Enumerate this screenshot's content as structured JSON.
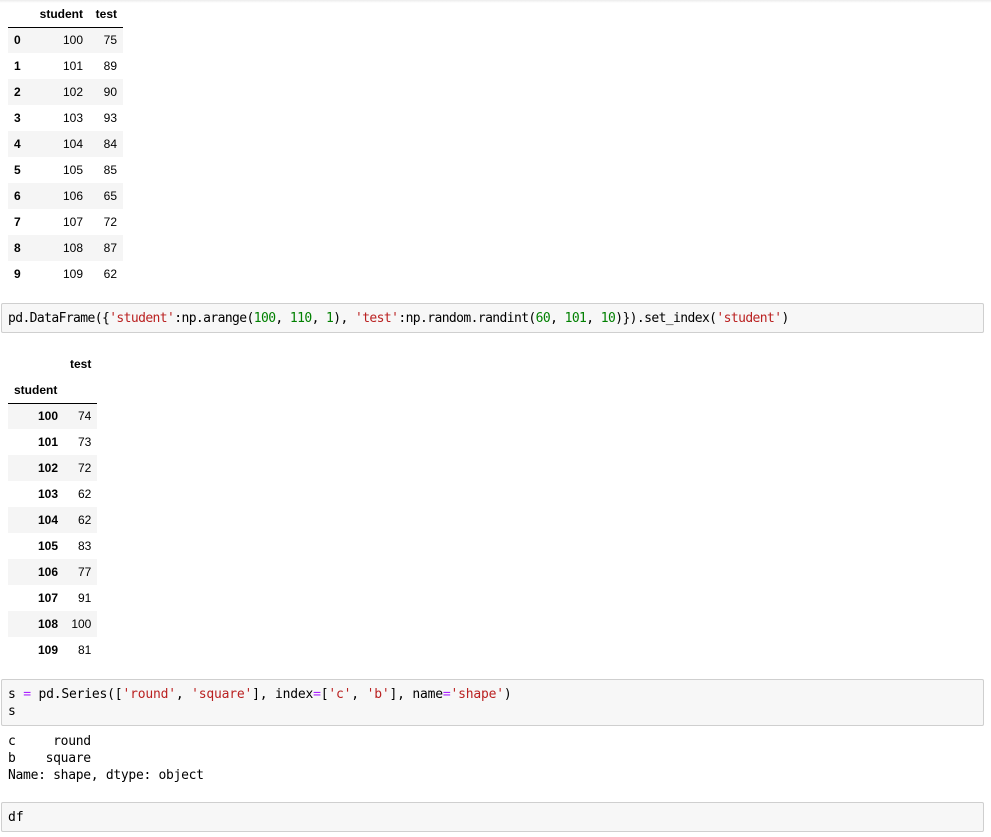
{
  "output_df_1": {
    "columns": [
      "student",
      "test"
    ],
    "rows": [
      {
        "index": "0",
        "student": "100",
        "test": "75"
      },
      {
        "index": "1",
        "student": "101",
        "test": "89"
      },
      {
        "index": "2",
        "student": "102",
        "test": "90"
      },
      {
        "index": "3",
        "student": "103",
        "test": "93"
      },
      {
        "index": "4",
        "student": "104",
        "test": "84"
      },
      {
        "index": "5",
        "student": "105",
        "test": "85"
      },
      {
        "index": "6",
        "student": "106",
        "test": "65"
      },
      {
        "index": "7",
        "student": "107",
        "test": "72"
      },
      {
        "index": "8",
        "student": "108",
        "test": "87"
      },
      {
        "index": "9",
        "student": "109",
        "test": "62"
      }
    ]
  },
  "cell_1": {
    "tokens": [
      {
        "t": "pd.DataFrame({",
        "k": "plain"
      },
      {
        "t": "'student'",
        "k": "str"
      },
      {
        "t": ":np.arange(",
        "k": "plain"
      },
      {
        "t": "100",
        "k": "num"
      },
      {
        "t": ", ",
        "k": "plain"
      },
      {
        "t": "110",
        "k": "num"
      },
      {
        "t": ", ",
        "k": "plain"
      },
      {
        "t": "1",
        "k": "num"
      },
      {
        "t": "), ",
        "k": "plain"
      },
      {
        "t": "'test'",
        "k": "str"
      },
      {
        "t": ":np.random.randint(",
        "k": "plain"
      },
      {
        "t": "60",
        "k": "num"
      },
      {
        "t": ", ",
        "k": "plain"
      },
      {
        "t": "101",
        "k": "num"
      },
      {
        "t": ", ",
        "k": "plain"
      },
      {
        "t": "10",
        "k": "num"
      },
      {
        "t": ")}).set_index(",
        "k": "plain"
      },
      {
        "t": "'student'",
        "k": "str"
      },
      {
        "t": ")",
        "k": "plain"
      }
    ]
  },
  "output_df_2": {
    "column": "test",
    "index_name": "student",
    "rows": [
      {
        "index": "100",
        "test": "74"
      },
      {
        "index": "101",
        "test": "73"
      },
      {
        "index": "102",
        "test": "72"
      },
      {
        "index": "103",
        "test": "62"
      },
      {
        "index": "104",
        "test": "62"
      },
      {
        "index": "105",
        "test": "83"
      },
      {
        "index": "106",
        "test": "77"
      },
      {
        "index": "107",
        "test": "91"
      },
      {
        "index": "108",
        "test": "100"
      },
      {
        "index": "109",
        "test": "81"
      }
    ]
  },
  "cell_2": {
    "tokens": [
      {
        "t": "s ",
        "k": "plain"
      },
      {
        "t": "=",
        "k": "op"
      },
      {
        "t": " pd.Series([",
        "k": "plain"
      },
      {
        "t": "'round'",
        "k": "str"
      },
      {
        "t": ", ",
        "k": "plain"
      },
      {
        "t": "'square'",
        "k": "str"
      },
      {
        "t": "], index",
        "k": "plain"
      },
      {
        "t": "=",
        "k": "op"
      },
      {
        "t": "[",
        "k": "plain"
      },
      {
        "t": "'c'",
        "k": "str"
      },
      {
        "t": ", ",
        "k": "plain"
      },
      {
        "t": "'b'",
        "k": "str"
      },
      {
        "t": "], name",
        "k": "plain"
      },
      {
        "t": "=",
        "k": "op"
      },
      {
        "t": "'shape'",
        "k": "str"
      },
      {
        "t": ")\ns",
        "k": "plain"
      }
    ]
  },
  "output_series": {
    "text": "c     round\nb    square\nName: shape, dtype: object"
  },
  "cell_3": {
    "tokens": [
      {
        "t": "df",
        "k": "plain"
      }
    ]
  },
  "colors": {
    "string": "#ba2121",
    "number": "#008000",
    "operator": "#aa22ff",
    "cell_background": "#f7f7f7",
    "cell_border": "#cfcfcf",
    "stripe": "#f5f5f5"
  }
}
